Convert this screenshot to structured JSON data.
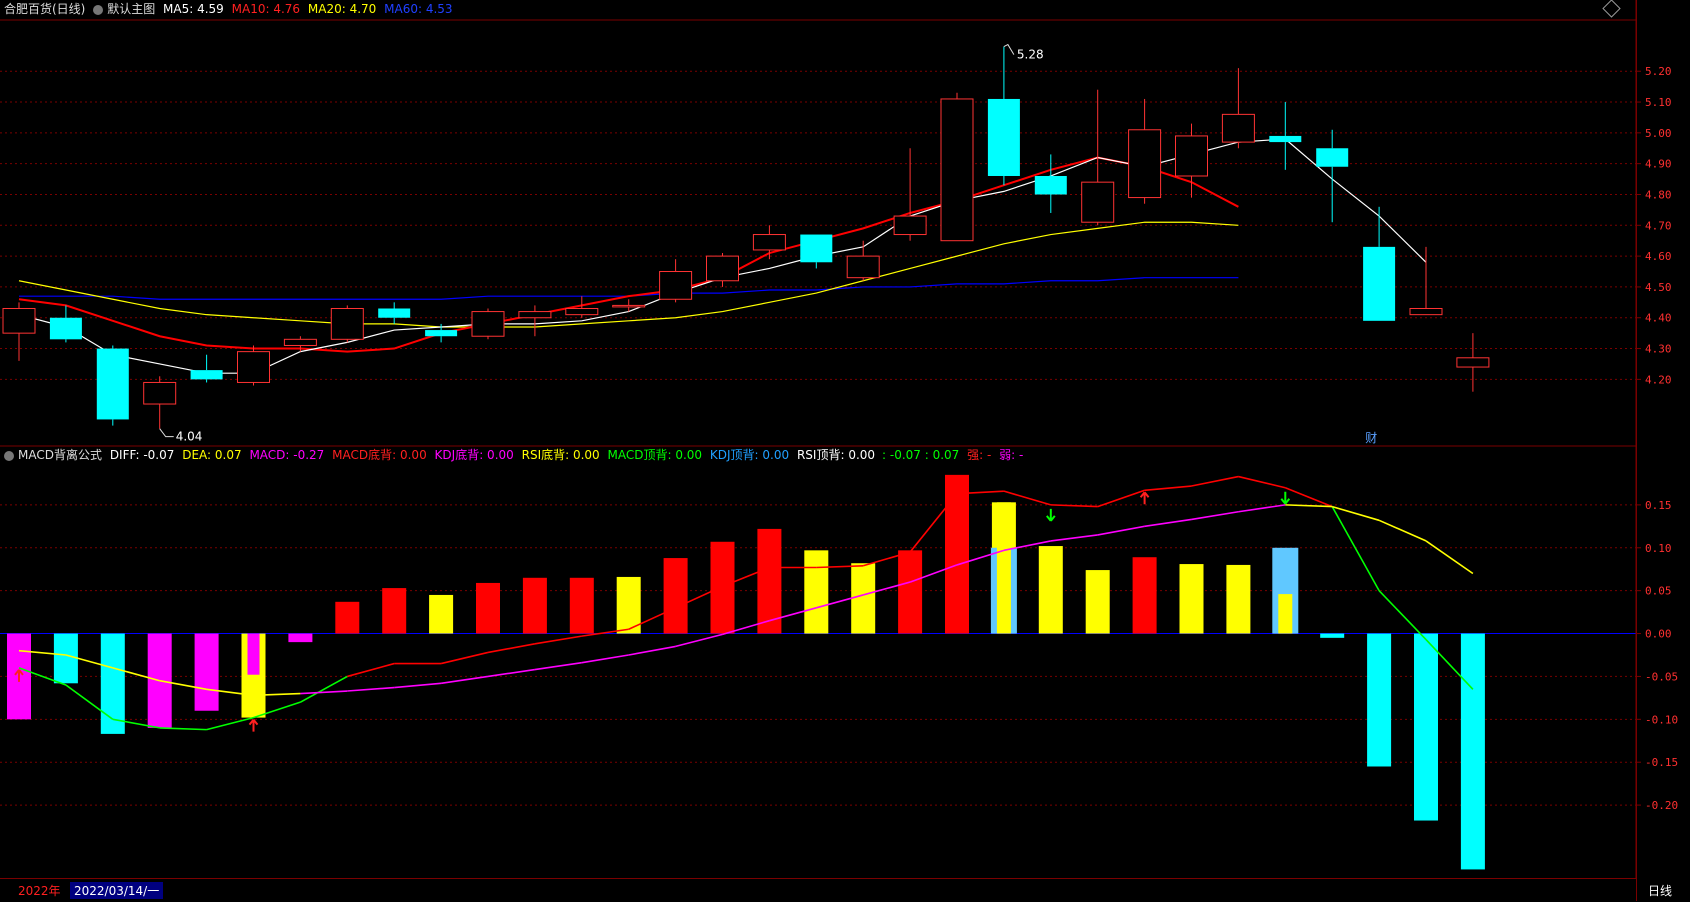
{
  "header": {
    "stock_name": "合肥百货(日线)",
    "main_chart_label": "默认主图",
    "ma5": "MA5: 4.59",
    "ma10": "MA10: 4.76",
    "ma20": "MA20: 4.70",
    "ma60": "MA60: 4.53"
  },
  "sub_header": {
    "indicator_name": "MACD背离公式",
    "diff": "DIFF: -0.07",
    "dea": "DEA: 0.07",
    "macd": "MACD: -0.27",
    "macd_bottom": "MACD底背: 0.00",
    "kdj_bottom": "KDJ底背: 0.00",
    "rsi_bottom": "RSI底背: 0.00",
    "macd_top": "MACD顶背: 0.00",
    "kdj_top": "KDJ顶背: 0.00",
    "rsi_top": "RSI顶背: 0.00",
    "extra_green": ": -0.07 : 0.07",
    "strong": "强: -",
    "weak": "弱: -"
  },
  "annotations": {
    "high_label": "5.28",
    "low_label": "4.04",
    "cai_label": "财"
  },
  "bottom": {
    "year": "2022年",
    "date": "2022/03/14/一",
    "period": "日线"
  },
  "colors": {
    "up": "#ff3333",
    "down": "#00ffff",
    "ma5": "#ffffff",
    "ma10": "#ff0000",
    "ma20": "#ffff00",
    "ma60": "#0000ff",
    "grid": "#7a0000",
    "diff": "#ff0000",
    "dea": "#ff00ff"
  },
  "chart_data": [
    {
      "type": "candlestick",
      "title": "合肥百货(日线)",
      "ylim": [
        4.0,
        5.35
      ],
      "yticks": [
        4.2,
        4.3,
        4.4,
        4.5,
        4.6,
        4.7,
        4.8,
        4.9,
        5.0,
        5.1,
        5.2
      ],
      "candles": [
        {
          "o": 4.35,
          "c": 4.43,
          "h": 4.45,
          "l": 4.26
        },
        {
          "o": 4.4,
          "c": 4.33,
          "h": 4.44,
          "l": 4.32
        },
        {
          "o": 4.3,
          "c": 4.07,
          "h": 4.31,
          "l": 4.05
        },
        {
          "o": 4.12,
          "c": 4.19,
          "h": 4.21,
          "l": 4.04
        },
        {
          "o": 4.23,
          "c": 4.2,
          "h": 4.28,
          "l": 4.19
        },
        {
          "o": 4.19,
          "c": 4.29,
          "h": 4.31,
          "l": 4.18
        },
        {
          "o": 4.31,
          "c": 4.33,
          "h": 4.34,
          "l": 4.29
        },
        {
          "o": 4.33,
          "c": 4.43,
          "h": 4.44,
          "l": 4.32
        },
        {
          "o": 4.43,
          "c": 4.4,
          "h": 4.45,
          "l": 4.38
        },
        {
          "o": 4.36,
          "c": 4.34,
          "h": 4.38,
          "l": 4.32
        },
        {
          "o": 4.34,
          "c": 4.42,
          "h": 4.43,
          "l": 4.33
        },
        {
          "o": 4.4,
          "c": 4.42,
          "h": 4.44,
          "l": 4.34
        },
        {
          "o": 4.41,
          "c": 4.43,
          "h": 4.47,
          "l": 4.4
        },
        {
          "o": 4.44,
          "c": 4.44,
          "h": 4.46,
          "l": 4.42
        },
        {
          "o": 4.46,
          "c": 4.55,
          "h": 4.59,
          "l": 4.45
        },
        {
          "o": 4.52,
          "c": 4.6,
          "h": 4.61,
          "l": 4.5
        },
        {
          "o": 4.62,
          "c": 4.67,
          "h": 4.7,
          "l": 4.59
        },
        {
          "o": 4.67,
          "c": 4.58,
          "h": 4.67,
          "l": 4.56
        },
        {
          "o": 4.53,
          "c": 4.6,
          "h": 4.65,
          "l": 4.52
        },
        {
          "o": 4.67,
          "c": 4.73,
          "h": 4.95,
          "l": 4.65
        },
        {
          "o": 4.65,
          "c": 5.11,
          "h": 5.13,
          "l": 4.65
        },
        {
          "o": 5.11,
          "c": 4.86,
          "h": 5.28,
          "l": 4.83
        },
        {
          "o": 4.86,
          "c": 4.8,
          "h": 4.93,
          "l": 4.74
        },
        {
          "o": 4.71,
          "c": 4.84,
          "h": 5.14,
          "l": 4.7
        },
        {
          "o": 4.79,
          "c": 5.01,
          "h": 5.11,
          "l": 4.77
        },
        {
          "o": 4.86,
          "c": 4.99,
          "h": 5.03,
          "l": 4.79
        },
        {
          "o": 4.97,
          "c": 5.06,
          "h": 5.21,
          "l": 4.95
        },
        {
          "o": 4.99,
          "c": 4.97,
          "h": 5.1,
          "l": 4.88
        },
        {
          "o": 4.95,
          "c": 4.89,
          "h": 5.01,
          "l": 4.71
        },
        {
          "o": 4.63,
          "c": 4.39,
          "h": 4.76,
          "l": 4.39
        },
        {
          "o": 4.41,
          "c": 4.43,
          "h": 4.63,
          "l": 4.41
        },
        {
          "o": 4.24,
          "c": 4.27,
          "h": 4.35,
          "l": 4.16
        }
      ],
      "ma5": [
        4.41,
        4.37,
        4.28,
        4.25,
        4.22,
        4.22,
        4.29,
        4.32,
        4.36,
        4.37,
        4.38,
        4.38,
        4.39,
        4.42,
        4.48,
        4.53,
        4.56,
        4.6,
        4.63,
        4.73,
        4.78,
        4.81,
        4.86,
        4.92,
        4.89,
        4.93,
        4.97,
        4.98,
        4.85,
        4.73,
        4.58
      ],
      "ma10": [
        4.46,
        4.44,
        4.39,
        4.34,
        4.31,
        4.3,
        4.3,
        4.29,
        4.3,
        4.35,
        4.38,
        4.41,
        4.44,
        4.47,
        4.49,
        4.53,
        4.61,
        4.65,
        4.69,
        4.74,
        4.78,
        4.83,
        4.88,
        4.92,
        4.89,
        4.84,
        4.76
      ],
      "ma20": [
        4.52,
        4.49,
        4.46,
        4.43,
        4.41,
        4.4,
        4.39,
        4.38,
        4.38,
        4.37,
        4.37,
        4.37,
        4.38,
        4.39,
        4.4,
        4.42,
        4.45,
        4.48,
        4.52,
        4.56,
        4.6,
        4.64,
        4.67,
        4.69,
        4.71,
        4.71,
        4.7
      ],
      "ma60": [
        4.47,
        4.47,
        4.47,
        4.46,
        4.46,
        4.46,
        4.46,
        4.46,
        4.46,
        4.46,
        4.47,
        4.47,
        4.47,
        4.47,
        4.48,
        4.48,
        4.49,
        4.49,
        4.5,
        4.5,
        4.51,
        4.51,
        4.52,
        4.52,
        4.53,
        4.53,
        4.53
      ]
    },
    {
      "type": "bar",
      "title": "MACD背离公式",
      "ylim": [
        -0.285,
        0.2
      ],
      "yticks": [
        0.15,
        0.1,
        0.05,
        0.0,
        -0.05,
        -0.1,
        -0.15,
        -0.2
      ],
      "macd_bars": [
        -0.1,
        -0.058,
        -0.117,
        -0.11,
        -0.09,
        -0.098,
        -0.01,
        0.037,
        0.053,
        0.045,
        0.059,
        0.065,
        0.065,
        0.066,
        0.088,
        0.107,
        0.122,
        0.097,
        0.082,
        0.097,
        0.185,
        0.153,
        0.102,
        0.074,
        0.089,
        0.081,
        0.08,
        0.046,
        -0.005,
        -0.155,
        -0.218,
        -0.275
      ],
      "macd_colors": [
        "magenta",
        "cyan",
        "cyan",
        "magenta",
        "magenta",
        "yellow",
        "magenta",
        "red",
        "red",
        "yellow",
        "red",
        "red",
        "red",
        "yellow",
        "red",
        "red",
        "red",
        "yellow",
        "yellow",
        "red",
        "red",
        "yellow",
        "yellow",
        "yellow",
        "red",
        "yellow",
        "yellow",
        "yellow",
        "cyan",
        "cyan",
        "cyan",
        "cyan"
      ],
      "extra_bars": [
        {
          "index": 5,
          "value": -0.048,
          "color": "magenta"
        },
        {
          "index": 21,
          "value": 0.1,
          "color": "lightblue"
        },
        {
          "index": 27,
          "value": 0.1,
          "color": "lightblue"
        }
      ],
      "diff": [
        -0.04,
        -0.06,
        -0.1,
        -0.11,
        -0.112,
        -0.098,
        -0.08,
        -0.05,
        -0.035,
        -0.035,
        -0.022,
        -0.012,
        -0.003,
        0.005,
        0.03,
        0.055,
        0.077,
        0.077,
        0.079,
        0.095,
        0.163,
        0.166,
        0.15,
        0.148,
        0.167,
        0.172,
        0.183,
        0.17,
        0.148,
        0.05,
        -0.007,
        -0.065
      ],
      "dea": [
        -0.02,
        -0.025,
        -0.04,
        -0.055,
        -0.065,
        -0.072,
        -0.07,
        -0.067,
        -0.063,
        -0.058,
        -0.05,
        -0.042,
        -0.034,
        -0.025,
        -0.015,
        -0.001,
        0.015,
        0.03,
        0.045,
        0.06,
        0.08,
        0.097,
        0.108,
        0.115,
        0.125,
        0.133,
        0.142,
        0.15,
        0.148,
        0.132,
        0.108,
        0.07
      ],
      "up_arrows": [
        0,
        5,
        24
      ],
      "down_arrows": [
        22,
        27
      ]
    }
  ]
}
